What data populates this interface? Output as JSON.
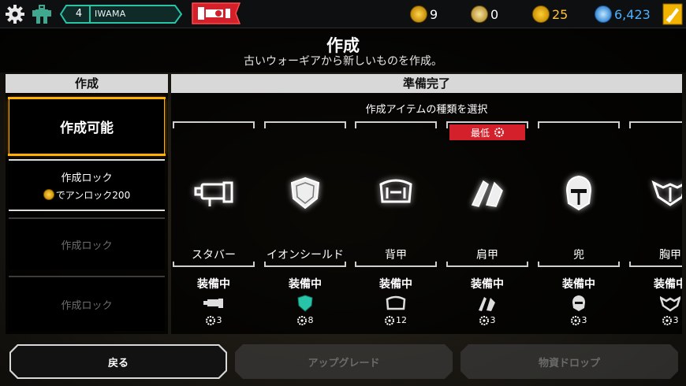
{
  "topbar": {
    "level": "4",
    "player_name": "IWAMA",
    "stats": [
      {
        "icon": "lightning-coin-icon",
        "value": "9"
      },
      {
        "icon": "crossed-tools-icon",
        "value": "0"
      },
      {
        "icon": "gold-coin-icon",
        "value": "25"
      },
      {
        "icon": "blue-crystal-icon",
        "value": "6,423"
      }
    ],
    "colors": {
      "gold": "#ffb000",
      "crystal_blue": "#4db1ff",
      "teal": "#28c4a8",
      "red": "#d4202a"
    }
  },
  "header": {
    "title": "作成",
    "subtitle": "古いウォーギアから新しいものを作成。"
  },
  "left": {
    "heading": "作成",
    "slots": [
      {
        "label": "作成可能",
        "state": "selected"
      },
      {
        "label": "作成ロック",
        "unlock_text": "でアンロック200"
      },
      {
        "label": "作成ロック",
        "state": "disabled"
      },
      {
        "label": "作成ロック",
        "state": "disabled"
      }
    ]
  },
  "main": {
    "heading": "準備完了",
    "subheading": "作成アイテムの種類を選択",
    "lowest_badge": "最低",
    "items": [
      {
        "name": "スタバー",
        "status": "装備中",
        "cost": "3",
        "icon": "stubber-gun-icon"
      },
      {
        "name": "イオンシールド",
        "status": "装備中",
        "cost": "8",
        "icon": "ion-shield-icon"
      },
      {
        "name": "背甲",
        "status": "装備中",
        "cost": "12",
        "icon": "carapace-icon"
      },
      {
        "name": "肩甲",
        "status": "装備中",
        "cost": "3",
        "icon": "pauldron-icon"
      },
      {
        "name": "兜",
        "status": "装備中",
        "cost": "3",
        "icon": "helmet-icon"
      },
      {
        "name": "胸甲",
        "status": "装備中",
        "cost": "3",
        "icon": "breastplate-icon"
      }
    ]
  },
  "buttons": {
    "back": "戻る",
    "upgrade": "アップグレード",
    "drop": "物資ドロップ"
  }
}
